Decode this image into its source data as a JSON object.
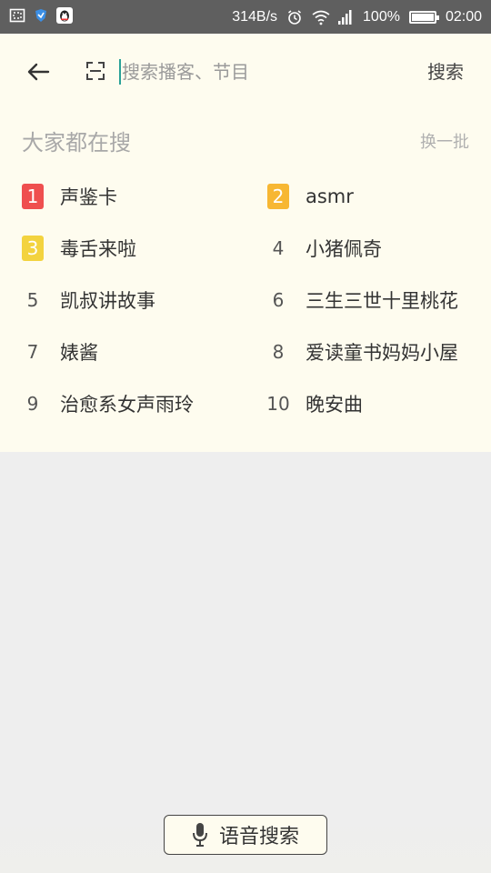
{
  "status_bar": {
    "network_speed": "314B/s",
    "battery_percent": "100%",
    "time": "02:00",
    "battery_level": 1.0
  },
  "search": {
    "placeholder": "搜索播客、节目",
    "value": "",
    "search_button_label": "搜索"
  },
  "hot_searches": {
    "title": "大家都在搜",
    "refresh_label": "换一批",
    "items": [
      {
        "rank": "1",
        "label": "声鉴卡",
        "badge_color": "#ef4f4f"
      },
      {
        "rank": "2",
        "label": "asmr",
        "badge_color": "#f7b733"
      },
      {
        "rank": "3",
        "label": "毒舌来啦",
        "badge_color": "#f3d33f"
      },
      {
        "rank": "4",
        "label": "小猪佩奇",
        "badge_color": ""
      },
      {
        "rank": "5",
        "label": "凯叔讲故事",
        "badge_color": ""
      },
      {
        "rank": "6",
        "label": "三生三世十里桃花",
        "badge_color": ""
      },
      {
        "rank": "7",
        "label": "婊酱",
        "badge_color": ""
      },
      {
        "rank": "8",
        "label": "爱读童书妈妈小屋",
        "badge_color": ""
      },
      {
        "rank": "9",
        "label": "治愈系女声雨玲",
        "badge_color": ""
      },
      {
        "rank": "10",
        "label": "晚安曲",
        "badge_color": ""
      }
    ]
  },
  "voice_search": {
    "label": "语音搜索",
    "icon": "microphone-icon"
  },
  "colors": {
    "top_background": "#fefcef",
    "page_background": "#eeeeee",
    "cursor": "#2aa198"
  }
}
